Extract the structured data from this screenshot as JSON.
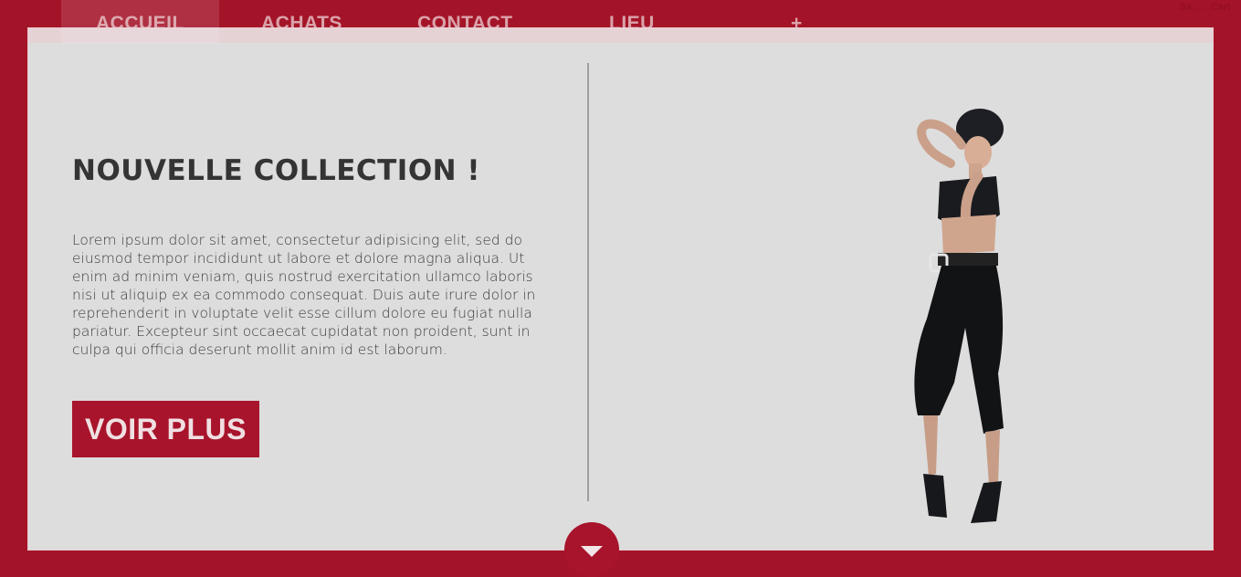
{
  "nav": {
    "items": [
      {
        "label": "ACCUEIL",
        "active": true
      },
      {
        "label": "ACHATS"
      },
      {
        "label": "CONTACT"
      },
      {
        "label": "LIEU"
      },
      {
        "label": "+"
      }
    ],
    "top_right": "Sa... ...Cart"
  },
  "hero": {
    "title": "NOUVELLE COLLECTION !",
    "description": "Lorem ipsum dolor sit amet, consectetur adipisicing elit, sed do eiusmod tempor incididunt ut labore et dolore magna aliqua. Ut enim ad minim veniam, quis nostrud exercitation ullamco laboris nisi ut aliquip ex ea commodo consequat. Duis aute irure dolor in reprehenderit in voluptate velit esse cillum dolore eu fugiat nulla pariatur. Excepteur sint occaecat cupidatat non proident, sunt in culpa qui officia deserunt mollit anim id est laborum.",
    "button_label": "VOIR PLUS"
  },
  "colors": {
    "brand": "#a41428",
    "panel": "#dddddd",
    "text": "#343434"
  },
  "icons": {
    "scroll": "chevron-down-icon"
  }
}
